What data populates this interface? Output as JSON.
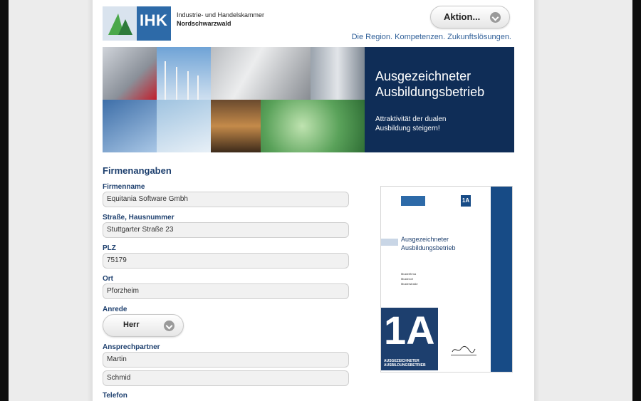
{
  "header": {
    "logo_text": "IHK",
    "logo_line1": "Industrie- und Handelskammer",
    "logo_line2": "Nordschwarzwald",
    "action_button": "Aktion...",
    "tagline": "Die Region. Kompetenzen. Zukunftslösungen."
  },
  "banner": {
    "title_line1": "Ausgezeichneter",
    "title_line2": "Ausbildungsbetrieb",
    "sub_line1": "Attraktivität der dualen",
    "sub_line2": "Ausbildung steigern!"
  },
  "form": {
    "section_title": "Firmenangaben",
    "firmenname_label": "Firmenname",
    "firmenname_value": "Equitania Software Gmbh",
    "strasse_label": "Straße, Hausnummer",
    "strasse_value": "Stuttgarter Straße 23",
    "plz_label": "PLZ",
    "plz_value": "75179",
    "ort_label": "Ort",
    "ort_value": "Pforzheim",
    "anrede_label": "Anrede",
    "anrede_value": "Herr",
    "ansprechpartner_label": "Ansprechpartner",
    "vorname_value": "Martin",
    "nachname_value": "Schmid",
    "telefon_label": "Telefon"
  },
  "certificate": {
    "title_line1": "Ausgezeichneter",
    "title_line2": "Ausbildungsbetrieb",
    "addr1": "Musterfirma",
    "addr2": "Musterort",
    "addr3": "Musterstraße",
    "badge": "1A",
    "caption_line1": "AUSGEZEICHNETER",
    "caption_line2": "AUSBILDUNGSBETRIEB"
  },
  "colors": {
    "brand_blue": "#1d3f6e",
    "banner_blue": "#0f2d57",
    "link_blue": "#2f5f98"
  }
}
